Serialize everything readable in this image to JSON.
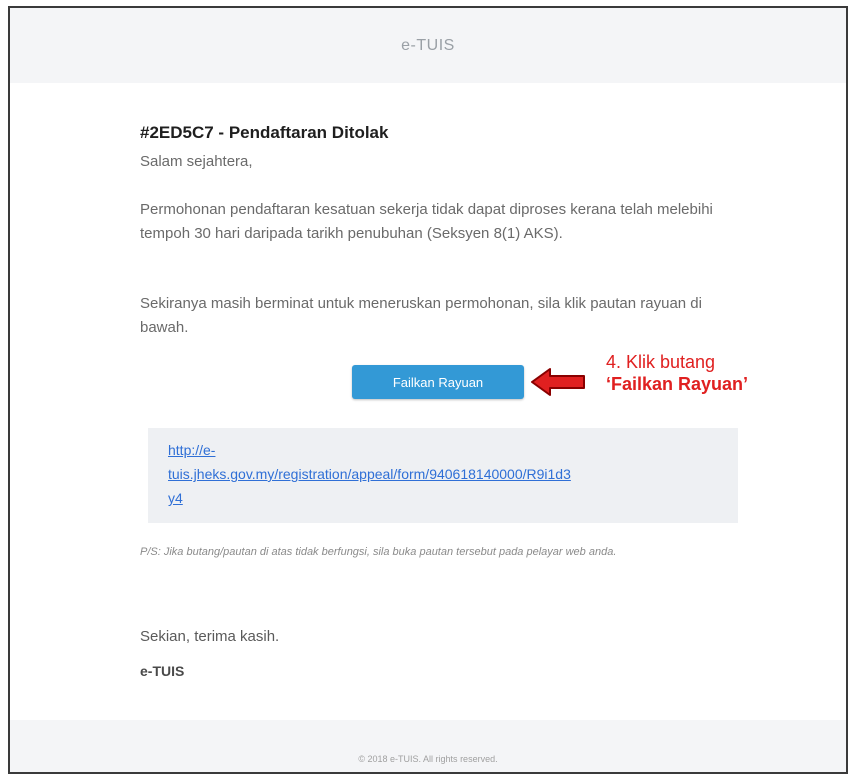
{
  "header": {
    "title": "e-TUIS"
  },
  "email": {
    "subject": "#2ED5C7 - Pendaftaran Ditolak",
    "greeting": "Salam sejahtera,",
    "paragraph1": "Permohonan pendaftaran kesatuan sekerja tidak dapat diproses kerana telah melebihi tempoh 30 hari daripada tarikh penubuhan (Seksyen 8(1) AKS).",
    "paragraph2": "Sekiranya masih berminat untuk meneruskan permohonan, sila klik pautan rayuan di bawah.",
    "appeal_button_label": "Failkan Rayuan",
    "appeal_link_line1": "http://e-",
    "appeal_link_line2": "tuis.jheks.gov.my/registration/appeal/form/940618140000/R9i1d3",
    "appeal_link_line3": "y4",
    "ps_note": "P/S: Jika butang/pautan di atas tidak berfungsi, sila buka pautan tersebut pada pelayar web anda.",
    "closing": "Sekian, terima kasih.",
    "signature": "e-TUIS"
  },
  "annotation": {
    "line1": "4. Klik butang",
    "line2": "‘Failkan Rayuan’",
    "color": "#e02020"
  },
  "footer": {
    "text": "© 2018 e-TUIS. All rights reserved."
  },
  "colors": {
    "button": "#3399d6",
    "link": "#2f6fd6",
    "header_bg": "#f4f5f7"
  }
}
